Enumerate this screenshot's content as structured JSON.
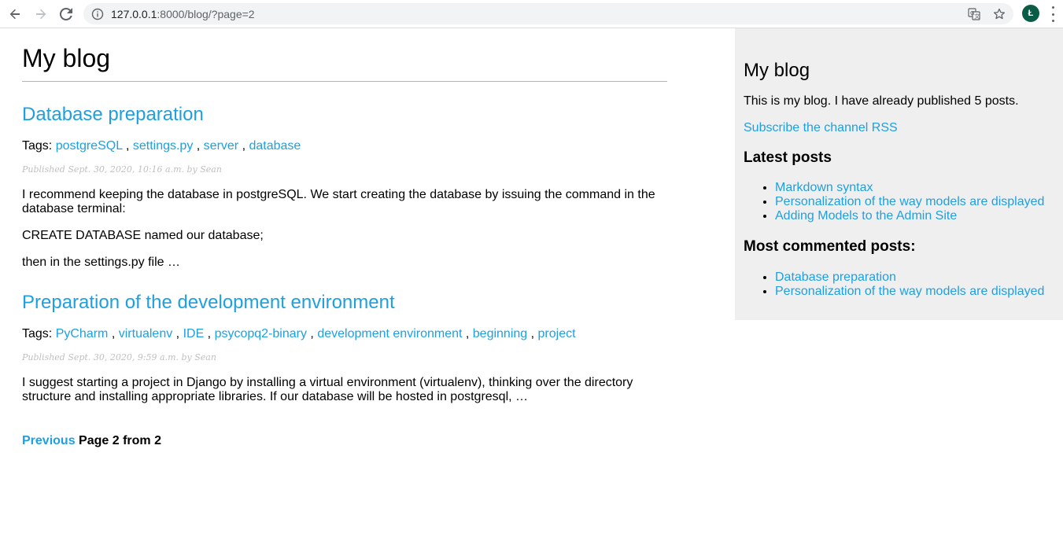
{
  "browser": {
    "url_host": "127.0.0.1",
    "url_path": ":8000/blog/?page=2",
    "avatar_letter": "Ł"
  },
  "blog": {
    "title": "My blog",
    "tags_label": "Tags:",
    "posts": [
      {
        "title": "Database preparation",
        "tags": [
          "postgreSQL",
          "settings.py",
          "server",
          "database"
        ],
        "date": "Published Sept. 30, 2020, 10:16 a.m. by Sean",
        "paragraphs": [
          "I recommend keeping the database in postgreSQL. We start creating the database by issuing the command in the database terminal:",
          "CREATE DATABASE named our database;",
          "then in the settings.py file …"
        ]
      },
      {
        "title": "Preparation of the development environment",
        "tags": [
          "PyCharm",
          "virtualenv",
          "IDE",
          "psycopq2-binary",
          "development environment",
          "beginning",
          "project"
        ],
        "date": "Published Sept. 30, 2020, 9:59 a.m. by Sean",
        "paragraphs": [
          "I suggest starting a project in Django by installing a virtual environment (virtualenv), thinking over the directory structure and installing appropriate libraries. If our database will be hosted in postgresql, …"
        ]
      }
    ],
    "pagination": {
      "previous_label": "Previous",
      "page_info": "Page 2 from 2"
    }
  },
  "sidebar": {
    "title": "My blog",
    "description": "This is my blog. I have already published 5 posts.",
    "rss_link": "Subscribe the channel RSS",
    "latest_heading": "Latest posts",
    "latest_posts": [
      "Markdown syntax",
      "Personalization of the way models are displayed",
      "Adding Models to the Admin Site"
    ],
    "most_commented_heading": "Most commented posts:",
    "most_commented_posts": [
      "Database preparation",
      "Personalization of the way models are displayed"
    ]
  },
  "colors": {
    "link": "#1ea0e0",
    "sidebar_bg": "#efefef",
    "date_text": "#c0c0c0"
  }
}
